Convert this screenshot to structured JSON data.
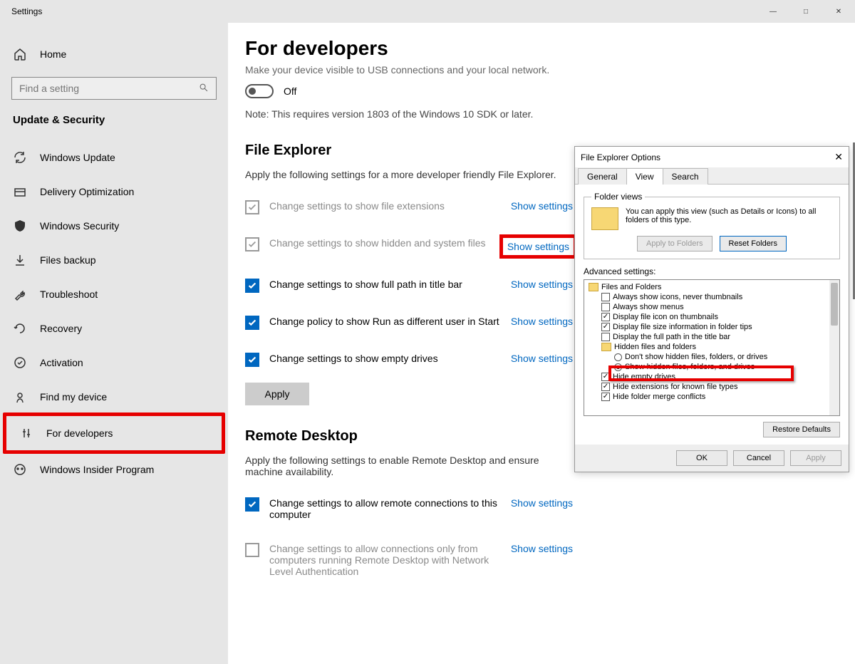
{
  "window": {
    "title": "Settings"
  },
  "sidebar": {
    "home": "Home",
    "search_placeholder": "Find a setting",
    "heading": "Update & Security",
    "items": [
      {
        "label": "Windows Update"
      },
      {
        "label": "Delivery Optimization"
      },
      {
        "label": "Windows Security"
      },
      {
        "label": "Files backup"
      },
      {
        "label": "Troubleshoot"
      },
      {
        "label": "Recovery"
      },
      {
        "label": "Activation"
      },
      {
        "label": "Find my device"
      },
      {
        "label": "For developers"
      },
      {
        "label": "Windows Insider Program"
      }
    ]
  },
  "page": {
    "title": "For developers",
    "subtitle": "Make your device visible to USB connections and your local network.",
    "toggle_label": "Off",
    "note": "Note: This requires version 1803 of the Windows 10 SDK or later.",
    "file_explorer": {
      "heading": "File Explorer",
      "subtitle": "Apply the following settings for a more developer friendly File Explorer.",
      "rows": [
        {
          "label": "Change settings to show file extensions",
          "link": "Show settings",
          "checked": false,
          "disabled": true
        },
        {
          "label": "Change settings to show hidden and system files",
          "link": "Show settings",
          "checked": false,
          "disabled": true,
          "highlight": true
        },
        {
          "label": "Change settings to show full path in title bar",
          "link": "Show settings",
          "checked": true
        },
        {
          "label": "Change policy to show Run as different user in Start",
          "link": "Show settings",
          "checked": true
        },
        {
          "label": "Change settings to show empty drives",
          "link": "Show settings",
          "checked": true
        }
      ],
      "apply": "Apply"
    },
    "remote_desktop": {
      "heading": "Remote Desktop",
      "subtitle": "Apply the following settings to enable Remote Desktop and ensure machine availability.",
      "rows": [
        {
          "label": "Change settings to allow remote connections to this computer",
          "link": "Show settings",
          "checked": true
        },
        {
          "label": "Change settings to allow connections only from computers running Remote Desktop with Network Level Authentication",
          "link": "Show settings",
          "checked": false,
          "disabled": true
        }
      ]
    }
  },
  "dialog": {
    "title": "File Explorer Options",
    "tabs": {
      "general": "General",
      "view": "View",
      "search": "Search"
    },
    "folder_views": {
      "legend": "Folder views",
      "text": "You can apply this view (such as Details or Icons) to all folders of this type.",
      "apply_btn": "Apply to Folders",
      "reset_btn": "Reset Folders"
    },
    "advanced": {
      "label": "Advanced settings:",
      "root": "Files and Folders",
      "items": [
        {
          "type": "check",
          "checked": false,
          "label": "Always show icons, never thumbnails"
        },
        {
          "type": "check",
          "checked": false,
          "label": "Always show menus"
        },
        {
          "type": "check",
          "checked": true,
          "label": "Display file icon on thumbnails"
        },
        {
          "type": "check",
          "checked": true,
          "label": "Display file size information in folder tips"
        },
        {
          "type": "check",
          "checked": false,
          "label": "Display the full path in the title bar"
        },
        {
          "type": "folder",
          "label": "Hidden files and folders"
        },
        {
          "type": "radio",
          "checked": false,
          "label": "Don't show hidden files, folders, or drives",
          "indent": true
        },
        {
          "type": "radio",
          "checked": true,
          "label": "Show hidden files, folders, and drives",
          "indent": true
        },
        {
          "type": "check",
          "checked": true,
          "label": "Hide empty drives"
        },
        {
          "type": "check",
          "checked": true,
          "label": "Hide extensions for known file types"
        },
        {
          "type": "check",
          "checked": true,
          "label": "Hide folder merge conflicts"
        }
      ]
    },
    "restore": "Restore Defaults",
    "ok": "OK",
    "cancel": "Cancel",
    "apply": "Apply"
  }
}
